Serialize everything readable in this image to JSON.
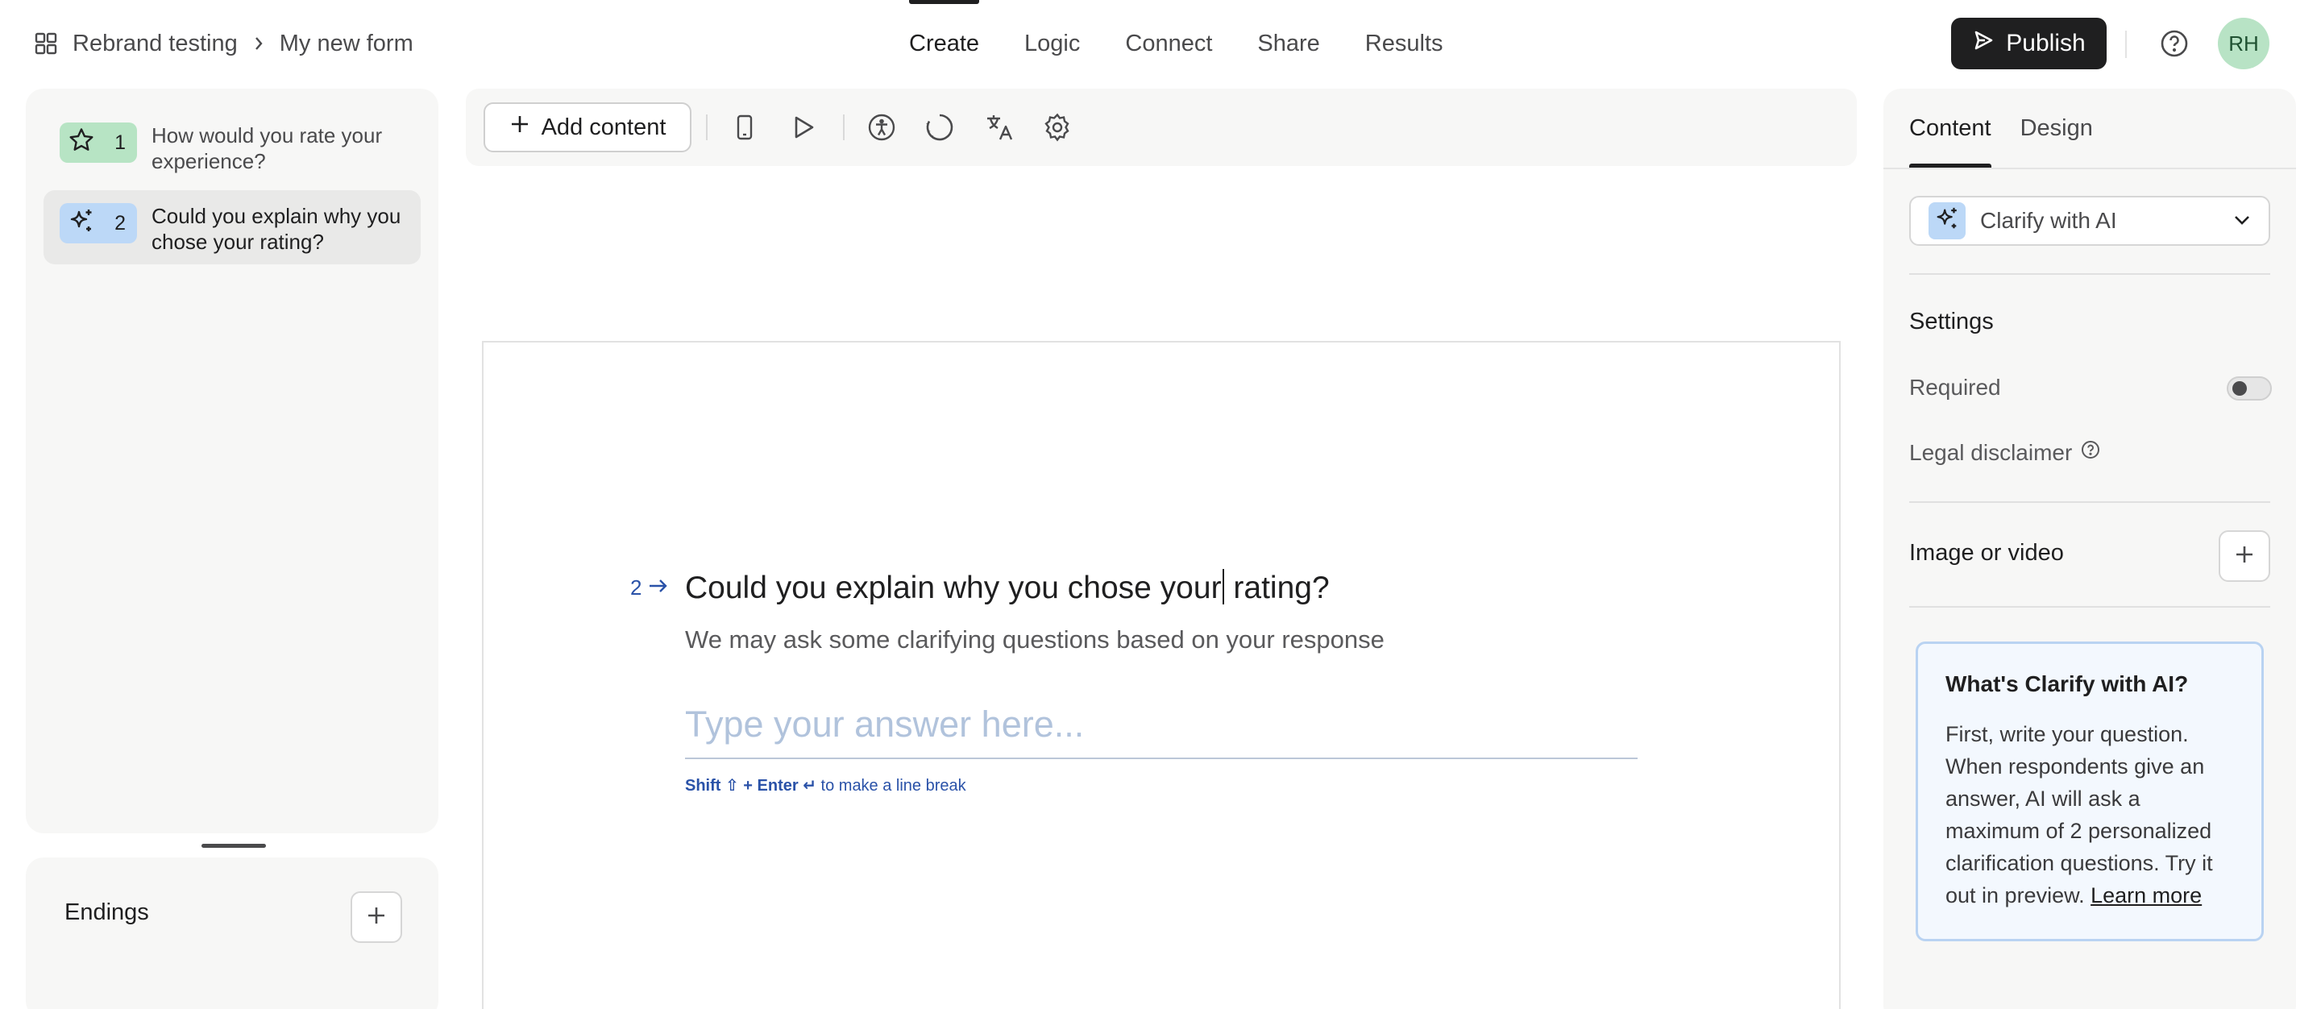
{
  "header": {
    "breadcrumb": {
      "workspace": "Rebrand testing",
      "form": "My new form"
    },
    "tabs": [
      {
        "label": "Create",
        "active": true
      },
      {
        "label": "Logic",
        "active": false
      },
      {
        "label": "Connect",
        "active": false
      },
      {
        "label": "Share",
        "active": false
      },
      {
        "label": "Results",
        "active": false
      }
    ],
    "publish_label": "Publish",
    "avatar_initials": "RH"
  },
  "questions": [
    {
      "number": "1",
      "text": "How would you rate your experience?",
      "icon": "star-icon",
      "color": "#b7e4c4"
    },
    {
      "number": "2",
      "text": "Could you explain why you chose your rating?",
      "icon": "sparkle-icon",
      "color": "#bcd8f7",
      "selected": true
    }
  ],
  "endings_label": "Endings",
  "toolbar": {
    "add_content_label": "Add content",
    "icons": [
      "mobile-preview-icon",
      "play-icon",
      "accessibility-icon",
      "loading-icon",
      "translate-icon",
      "settings-icon"
    ]
  },
  "canvas": {
    "question_number": "2",
    "title_before_caret": "Could you explain why you chose your",
    "title_after_caret": " rating?",
    "description": "We may ask some clarifying questions based on your response",
    "answer_placeholder": "Type your answer here...",
    "hint": {
      "shift": "Shift ⇧",
      "plus": " + ",
      "enter": "Enter ↵",
      "rest": " to make a line break"
    }
  },
  "right_panel": {
    "tabs": [
      {
        "label": "Content",
        "active": true
      },
      {
        "label": "Design",
        "active": false
      }
    ],
    "question_type": "Clarify with AI",
    "settings_heading": "Settings",
    "required_label": "Required",
    "required_enabled": false,
    "legal_label": "Legal disclaimer",
    "image_label": "Image or video",
    "info": {
      "title": "What's Clarify with AI?",
      "body": "First, write your question. When respondents give an answer, AI will ask a maximum of 2 personalized clarification questions. Try it out in preview. ",
      "link": "Learn more"
    }
  },
  "colors": {
    "accent_dark": "#1f1f20",
    "link_blue": "#2a52a8",
    "avatar_bg": "#b8e3c5"
  }
}
